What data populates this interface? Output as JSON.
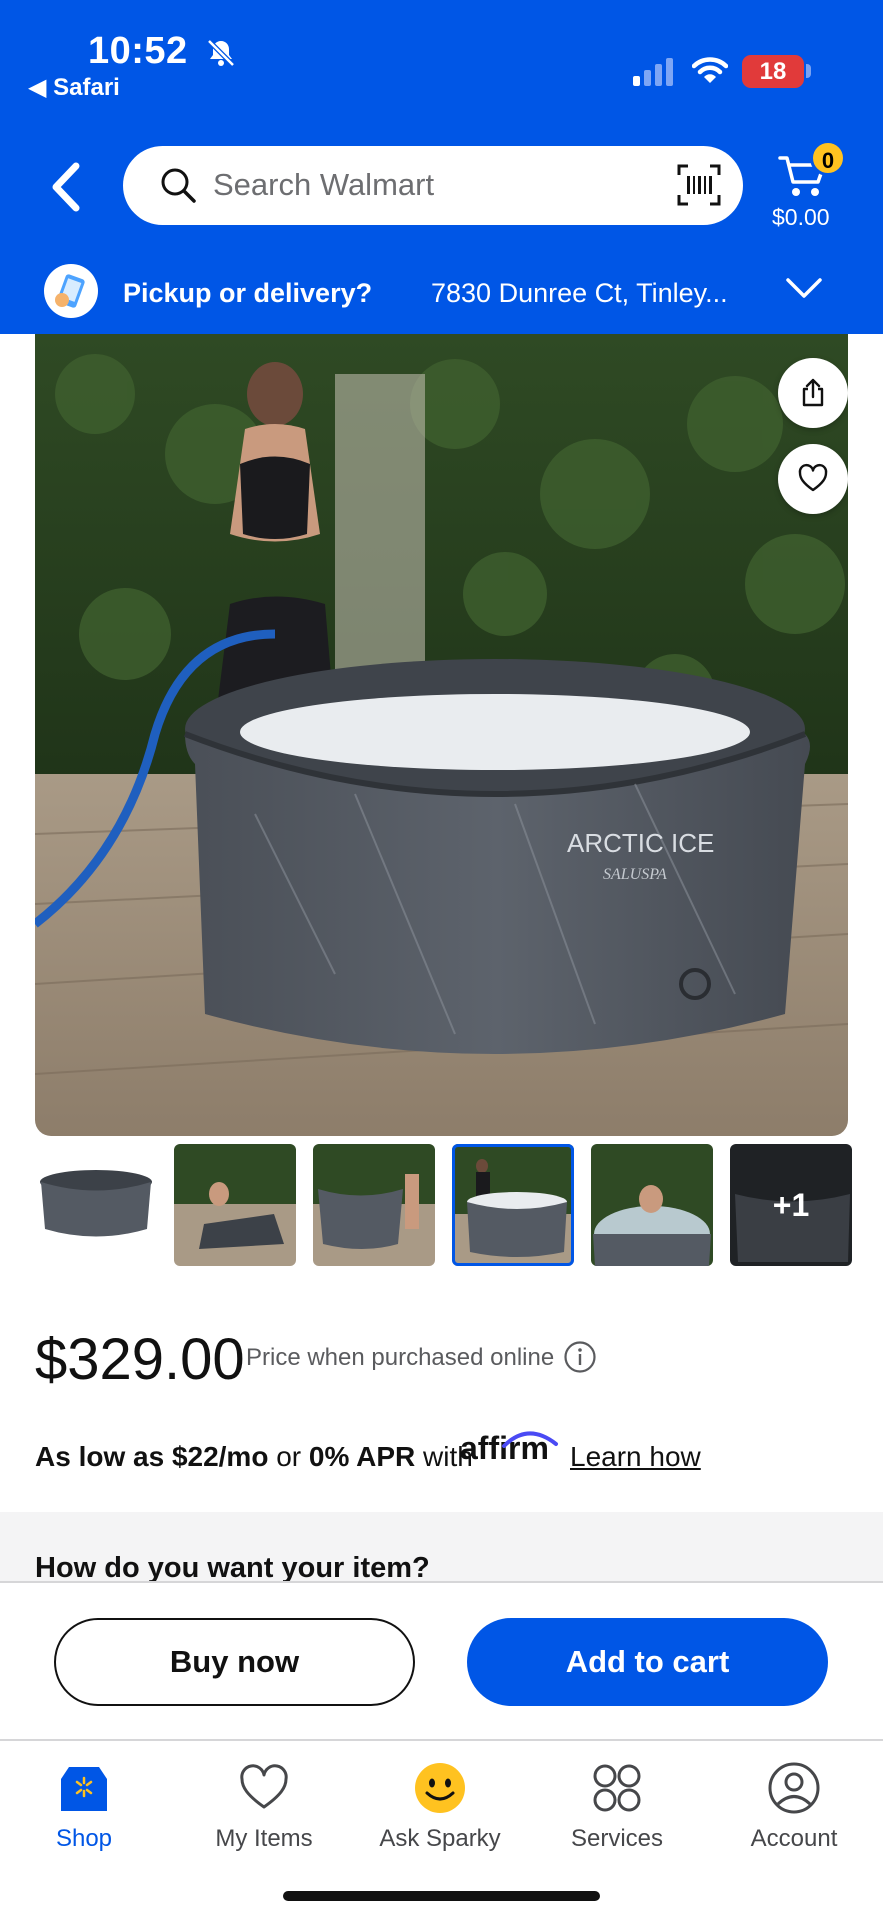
{
  "status_bar": {
    "time": "10:52",
    "back_app": "◀ Safari",
    "battery": "18",
    "icons": [
      "bell-slash-icon",
      "signal-icon",
      "wifi-icon",
      "battery-icon"
    ]
  },
  "header": {
    "search_placeholder": "Search Walmart",
    "cart_count": "0",
    "cart_total": "$0.00",
    "pickup_label": "Pickup or delivery?",
    "pickup_address": "7830 Dunree Ct, Tinley...",
    "icons": [
      "back-chevron-icon",
      "search-icon",
      "barcode-scan-icon",
      "cart-icon",
      "chevron-down-icon"
    ]
  },
  "product": {
    "hero_brand_text": "ARCTIC ICE",
    "hero_brand_sub": "SALUSPA",
    "thumbnails": [
      {
        "selected": false,
        "overlay": ""
      },
      {
        "selected": false,
        "overlay": ""
      },
      {
        "selected": false,
        "overlay": ""
      },
      {
        "selected": true,
        "overlay": ""
      },
      {
        "selected": false,
        "overlay": ""
      },
      {
        "selected": false,
        "overlay": "+1"
      }
    ],
    "price": "$329.00",
    "price_note": "Price when purchased online",
    "affirm": {
      "prefix": "As low as ",
      "monthly": "$22/mo",
      "middle": " or ",
      "apr": "0% APR",
      "suffix": " with",
      "logo_text": "affirm",
      "learn_how": "Learn how"
    },
    "fulfillment_heading": "How do you want your item?"
  },
  "actions": {
    "buy_now": "Buy now",
    "add_to_cart": "Add to cart"
  },
  "bottom_nav": [
    {
      "label": "Shop",
      "icon": "shop-icon",
      "active": true
    },
    {
      "label": "My Items",
      "icon": "heart-icon",
      "active": false
    },
    {
      "label": "Ask Sparky",
      "icon": "sparky-smiley-icon",
      "active": false
    },
    {
      "label": "Services",
      "icon": "services-grid-icon",
      "active": false
    },
    {
      "label": "Account",
      "icon": "account-icon",
      "active": false
    }
  ],
  "colors": {
    "walmart_blue": "#0056e6",
    "spark_yellow": "#ffc220",
    "battery_red": "#e13a3a"
  }
}
